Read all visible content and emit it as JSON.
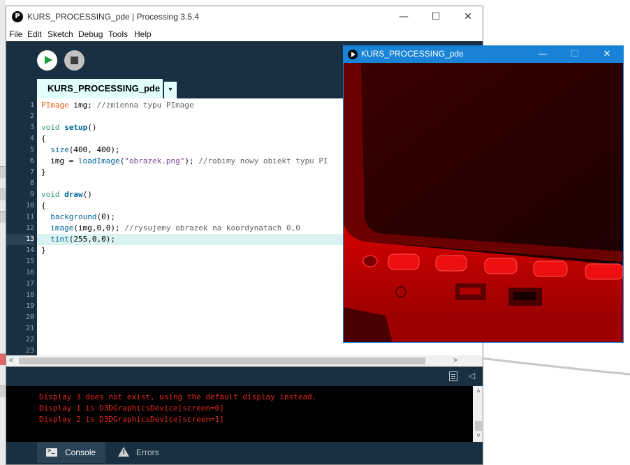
{
  "main_window": {
    "title": "KURS_PROCESSING_pde | Processing 3.5.4",
    "icon_glyph": "P",
    "controls": {
      "minimize": "—",
      "maximize": "☐",
      "close": "✕"
    }
  },
  "menubar": {
    "items": [
      "File",
      "Edit",
      "Sketch",
      "Debug",
      "Tools",
      "Help"
    ]
  },
  "toolbar": {
    "run_icon": "play-icon",
    "stop_icon": "stop-icon"
  },
  "tabs": {
    "active": "KURS_PROCESSING_pde",
    "menu_glyph": "▾"
  },
  "editor": {
    "current_line": 13,
    "line_numbers": [
      "1",
      "2",
      "3",
      "4",
      "5",
      "6",
      "7",
      "8",
      "9",
      "10",
      "11",
      "12",
      "13",
      "14",
      "15",
      "16",
      "17",
      "18",
      "19",
      "20",
      "21",
      "22",
      "23"
    ],
    "lines": [
      [
        {
          "t": "PImage",
          "c": "kw-type"
        },
        {
          "t": " img; ",
          "c": "plain"
        },
        {
          "t": "//zmienna typu PImage",
          "c": "cmt"
        }
      ],
      [],
      [
        {
          "t": "void",
          "c": "kw-struct"
        },
        {
          "t": " ",
          "c": "plain"
        },
        {
          "t": "setup",
          "c": "fn"
        },
        {
          "t": "()",
          "c": "plain"
        }
      ],
      [
        {
          "t": "{",
          "c": "plain"
        }
      ],
      [
        {
          "t": "  ",
          "c": "plain"
        },
        {
          "t": "size",
          "c": "call"
        },
        {
          "t": "(400, 400);",
          "c": "plain"
        }
      ],
      [
        {
          "t": "  img = ",
          "c": "plain"
        },
        {
          "t": "loadImage",
          "c": "call"
        },
        {
          "t": "(",
          "c": "plain"
        },
        {
          "t": "\"obrazek.png\"",
          "c": "str"
        },
        {
          "t": "); ",
          "c": "plain"
        },
        {
          "t": "//robimy nowy obiekt typu PI",
          "c": "cmt"
        }
      ],
      [
        {
          "t": "}",
          "c": "plain"
        }
      ],
      [],
      [
        {
          "t": "void",
          "c": "kw-struct"
        },
        {
          "t": " ",
          "c": "plain"
        },
        {
          "t": "draw",
          "c": "fn"
        },
        {
          "t": "()",
          "c": "plain"
        }
      ],
      [
        {
          "t": "{",
          "c": "plain"
        }
      ],
      [
        {
          "t": "  ",
          "c": "plain"
        },
        {
          "t": "background",
          "c": "call"
        },
        {
          "t": "(0);",
          "c": "plain"
        }
      ],
      [
        {
          "t": "  ",
          "c": "plain"
        },
        {
          "t": "image",
          "c": "call"
        },
        {
          "t": "(img,0,0); ",
          "c": "plain"
        },
        {
          "t": "//rysujemy obrazek na koordynatach 0,0",
          "c": "cmt"
        }
      ],
      [
        {
          "t": "  ",
          "c": "plain"
        },
        {
          "t": "tint",
          "c": "call"
        },
        {
          "t": "(255,0,0);",
          "c": "plain"
        }
      ],
      [
        {
          "t": "}",
          "c": "plain"
        }
      ]
    ]
  },
  "scrollbar": {
    "left_arrow": "<",
    "right_arrow": ">",
    "up_arrow": "˄",
    "down_arrow": "˅"
  },
  "divider": {
    "collapse_glyph": "◁"
  },
  "console": {
    "lines": [
      "Display 3 does not exist, using the default display instead.",
      "Display 1 is D3DGraphicsDevice[screen=0]",
      "Display 2 is D3DGraphicsDevice[screen=1]"
    ],
    "text_color": "#e3261f"
  },
  "statusbar": {
    "console_tab": "Console",
    "errors_tab": "Errors"
  },
  "sketch_window": {
    "title": "KURS_PROCESSING_pde",
    "controls": {
      "minimize": "—",
      "maximize": "☐",
      "close": "✕"
    },
    "tint": "#ff0000"
  },
  "colors": {
    "editor_chrome": "#193042",
    "tab_active": "#e0fffd",
    "sketch_titlebar": "#1883d7"
  }
}
